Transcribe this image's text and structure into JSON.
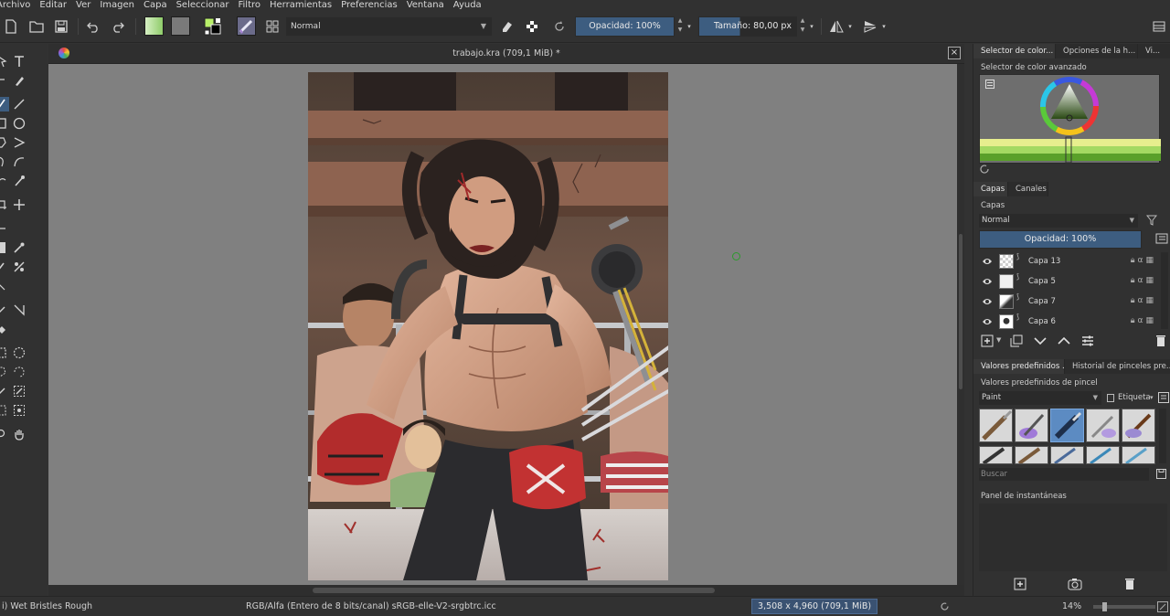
{
  "menubar": {
    "items": [
      "Archivo",
      "Editar",
      "Ver",
      "Imagen",
      "Capa",
      "Seleccionar",
      "Filtro",
      "Herramientas",
      "Preferencias",
      "Ventana",
      "Ayuda"
    ]
  },
  "toolbar": {
    "blend_mode": "Normal",
    "opacity_label": "Opacidad: 100%",
    "size_label": "Tamaño: 80,00 px",
    "colors": {
      "foreground": "#000000",
      "background": "#ffffff",
      "gradient_start": "#a8d88a",
      "pattern": "#7a7a7a"
    }
  },
  "document": {
    "title": "trabajo.kra (709,1 MiB) *",
    "close_label": "×"
  },
  "docker": {
    "color_tabs": [
      "Selector de color...",
      "Opciones de la h...",
      "Vi..."
    ],
    "color_selector_title": "Selector de color avanzado",
    "layers_tabs": [
      "Capas",
      "Canales"
    ],
    "layers_title": "Capas",
    "layers_blend": "Normal",
    "layers_opacity": "Opacidad:  100%",
    "layers": [
      {
        "name": "Capa 13"
      },
      {
        "name": "Capa 5"
      },
      {
        "name": "Capa 7"
      },
      {
        "name": "Capa 6"
      }
    ],
    "preset_tabs": [
      "Valores predefinidos ...",
      "Historial de pinceles pre..."
    ],
    "presets_title": "Valores predefinidos de pincel",
    "preset_filter": "Paint",
    "tag_label": "Etiqueta",
    "search_placeholder": "Buscar",
    "snapshot_title": "Panel de instantáneas"
  },
  "status": {
    "brush": "i) Wet Bristles Rough",
    "colorspace": "RGB/Alfa (Entero de 8 bits/canal)  sRGB-elle-V2-srgbtrc.icc",
    "dimensions": "3,508 x 4,960 (709,1 MiB)",
    "zoom": "14%"
  }
}
